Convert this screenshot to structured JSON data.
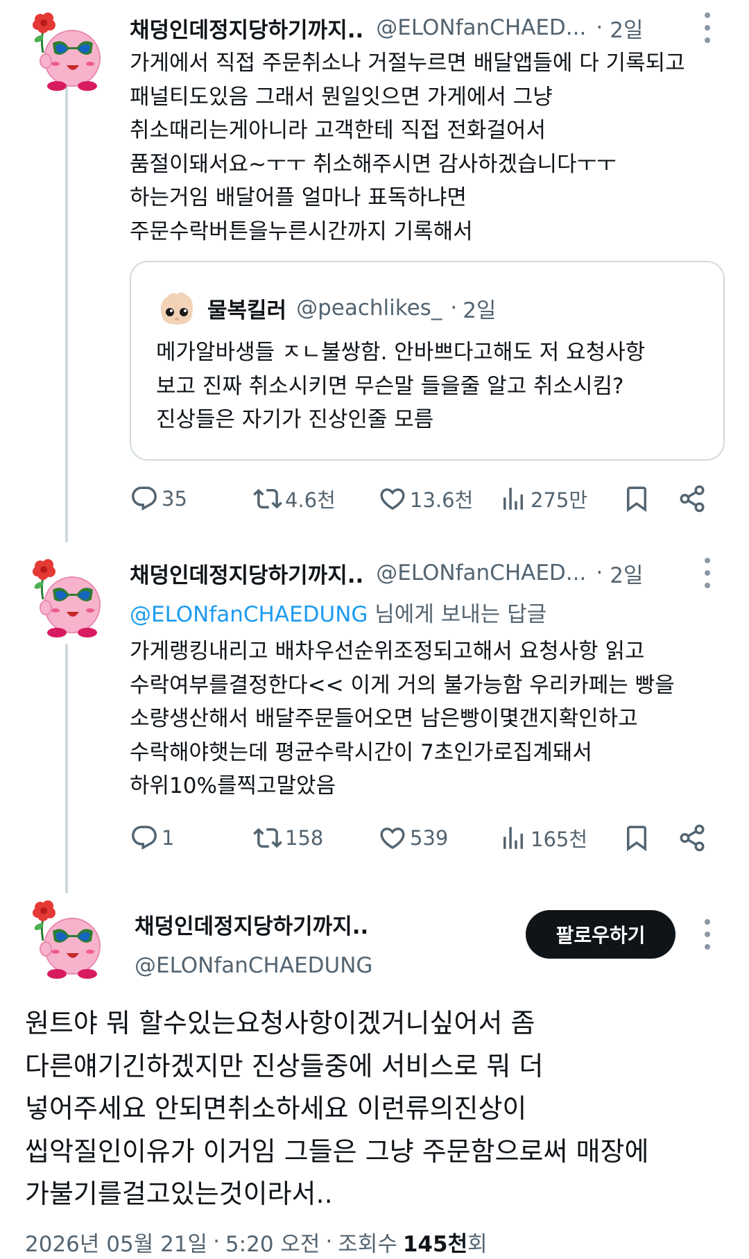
{
  "colors": {
    "text_primary": "#0f1419",
    "text_secondary": "#536471",
    "link": "#1d9bf0",
    "border": "#cfd9de",
    "follow_button_bg": "#0f1419"
  },
  "tweet1": {
    "display_name": "채덩인데정지당하기까지..",
    "handle": "@ELONfanCHAED...",
    "separator": "·",
    "time": "2일",
    "text_lines": [
      "가게에서 직접 주문취소나 거절누르면 배달앱들에 다 기록되고",
      "패널티도있음 그래서 뭔일잇으면 가게에서 그냥",
      "취소때리는게아니라 고객한테 직접 전화걸어서",
      "품절이돼서요~ㅜㅜ 취소해주시면 감사하겠습니다ㅜㅜ",
      "하는거임 배달어플 얼마나 표독하냐면",
      "주문수락버튼을누른시간까지 기록해서"
    ],
    "quote": {
      "display_name": "물복킬러",
      "handle": "@peachlikes_",
      "separator": "·",
      "time": "2일",
      "text_lines": [
        "메가알바생들 ㅈㄴ불쌍함. 안바쁘다고해도 저 요청사항",
        "보고 진짜 취소시키면 무슨말 들을줄 알고 취소시킴?",
        "진상들은 자기가 진상인줄 모름"
      ]
    },
    "actions": {
      "replies": "35",
      "retweets": "4.6천",
      "likes": "13.6천",
      "views": "275만"
    }
  },
  "tweet2": {
    "display_name": "채덩인데정지당하기까지..",
    "handle": "@ELONfanCHAED...",
    "separator": "·",
    "time": "2일",
    "reply_mention": "@ELONfanCHAEDUNG",
    "reply_suffix": " 님에게 보내는 답글",
    "text_lines": [
      "가게랭킹내리고 배차우선순위조정되고해서 요청사항 읽고",
      "수락여부를결정한다<< 이게 거의 불가능함 우리카페는 빵을",
      "소량생산해서 배달주문들어오면 남은빵이몇갠지확인하고",
      "수락해야햇는데 평균수락시간이 7초인가로집계돼서",
      "하위10%를찍고말았음"
    ],
    "actions": {
      "replies": "1",
      "retweets": "158",
      "likes": "539",
      "views": "165천"
    }
  },
  "main_tweet": {
    "display_name": "채덩인데정지당하기까지..",
    "handle": "@ELONfanCHAEDUNG",
    "follow_label": "팔로우하기",
    "text_lines": [
      "원트야 뭐 할수있는요청사항이겠거니싶어서 좀",
      "다른얘기긴하겠지만 진상들중에 서비스로 뭐 더",
      "넣어주세요 안되면취소하세요 이런류의진상이",
      "씹악질인이유가 이거임 그들은 그냥 주문함으로써 매장에",
      "가불기를걸고있는것이라서.."
    ],
    "date": "2026년 05월 21일",
    "time": "5:20 오전",
    "separator": "·",
    "views_label": "조회수",
    "views_count": "145천",
    "views_suffix": "회"
  }
}
